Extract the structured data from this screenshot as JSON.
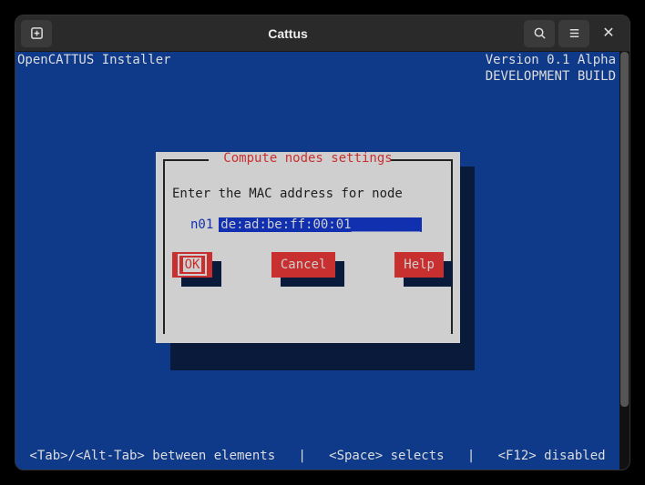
{
  "window": {
    "title": "Cattus"
  },
  "header": {
    "left": "OpenCATTUS Installer",
    "right1": "Version 0.1 Alpha",
    "right2": "DEVELOPMENT BUILD"
  },
  "dialog": {
    "title": "Compute nodes settings",
    "prompt": "Enter the MAC address for node",
    "node_label": "n01",
    "mac_value": "de:ad:be:ff:00:01_________",
    "buttons": {
      "ok": "OK",
      "cancel": "Cancel",
      "help": "Help"
    }
  },
  "footer": {
    "hint": "<Tab>/<Alt-Tab> between elements   |   <Space> selects   |   <F12> disabled"
  },
  "colors": {
    "term_bg": "#0f3a8a",
    "accent_red": "#c83030",
    "dlg_bg": "#cfcfcf"
  }
}
